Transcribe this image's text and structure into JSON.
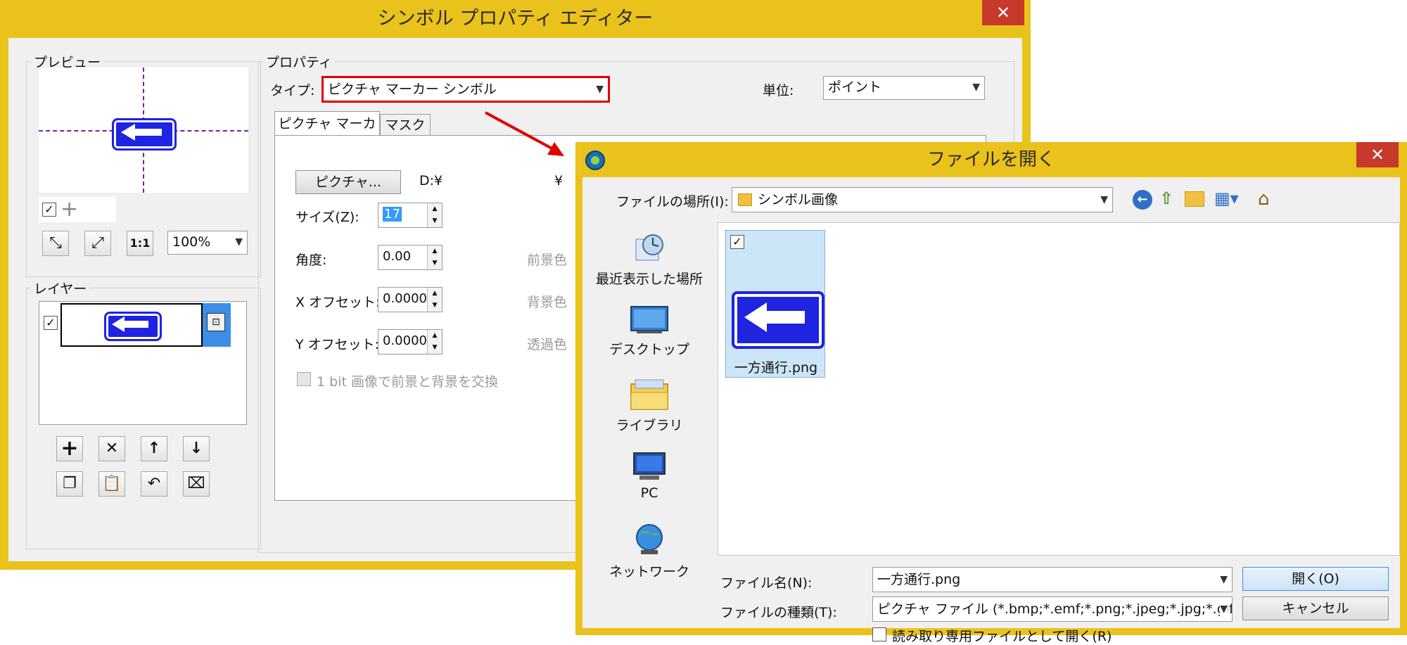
{
  "main_window": {
    "title": "シンボル プロパティ エディター",
    "close": "✕",
    "preview": {
      "legend": "プレビュー",
      "zoom": "100%",
      "one_to_one": "1:1"
    },
    "layers": {
      "legend": "レイヤー"
    },
    "properties": {
      "legend": "プロパティ",
      "type_label": "タイプ:",
      "type_value": "ピクチャ マーカー シンボル",
      "unit_label": "単位:",
      "unit_value": "ポイント",
      "tabs": [
        "ピクチャ マーカー",
        "マスク"
      ],
      "picture_button": "ピクチャ...",
      "path_text": "D:¥",
      "path_tail": "¥",
      "size_label": "サイズ(Z):",
      "size_value": "17",
      "angle_label": "角度:",
      "angle_value": "0.00",
      "xoffset_label": "X オフセット:",
      "xoffset_value": "0.0000",
      "yoffset_label": "Y オフセット:",
      "yoffset_value": "0.0000",
      "fg_color_label": "前景色",
      "bg_color_label": "背景色",
      "transparent_label": "透過色",
      "swap_label": "1 bit 画像で前景と背景を交換"
    }
  },
  "open_dialog": {
    "title": "ファイルを開く",
    "close": "✕",
    "location_label": "ファイルの場所(I):",
    "location_value": "シンボル画像",
    "places": [
      "最近表示した場所",
      "デスクトップ",
      "ライブラリ",
      "PC",
      "ネットワーク"
    ],
    "file_item": "一方通行.png",
    "filename_label": "ファイル名(N):",
    "filename_value": "一方通行.png",
    "filetype_label": "ファイルの種類(T):",
    "filetype_value": "ピクチャ ファイル (*.bmp;*.emf;*.png;*.jpeg;*.jpg;*.gif)",
    "readonly_label": "読み取り専用ファイルとして開く(R)",
    "open_button": "開く(O)",
    "cancel_button": "キャンセル"
  },
  "colors": {
    "title_bar": "#eac21c",
    "close": "#c7392b",
    "sign_blue": "#1e24e0",
    "highlight": "#cde6f7",
    "callout": "#e00000"
  }
}
